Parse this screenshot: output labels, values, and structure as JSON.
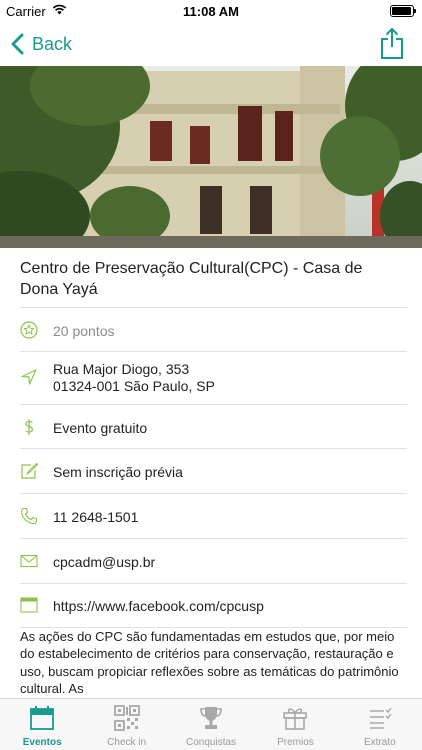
{
  "status_bar": {
    "carrier": "Carrier",
    "time": "11:08 AM",
    "battery_level": 0.95
  },
  "nav": {
    "back_label": "Back"
  },
  "event": {
    "title": "Centro de Preservação Cultural(CPC) - Casa de Dona Yayá",
    "points": "20 pontos",
    "address_line1": "Rua Major Diogo, 353",
    "address_line2": "01324-001 São Paulo, SP",
    "price": "Evento gratuito",
    "registration": "Sem inscrição prévia",
    "phone": "11 2648-1501",
    "email": "cpcadm@usp.br",
    "website": "https://www.facebook.com/cpcusp",
    "description": "As ações do CPC são fundamentadas em estudos que, por meio do estabelecimento de critérios para conservação, restauração e uso, buscam propiciar reflexões sobre as temáticas do patrimônio cultural. As"
  },
  "tabs": [
    {
      "label": "Eventos",
      "icon": "calendar-icon",
      "active": true
    },
    {
      "label": "Check in",
      "icon": "qr-code-icon",
      "active": false
    },
    {
      "label": "Conquistas",
      "icon": "trophy-icon",
      "active": false
    },
    {
      "label": "Premios",
      "icon": "gift-icon",
      "active": false
    },
    {
      "label": "Extrato",
      "icon": "checklist-icon",
      "active": false
    }
  ],
  "colors": {
    "accent": "#1a9a8e",
    "icon_green": "#8bc34a",
    "muted": "#8a8a8a"
  }
}
